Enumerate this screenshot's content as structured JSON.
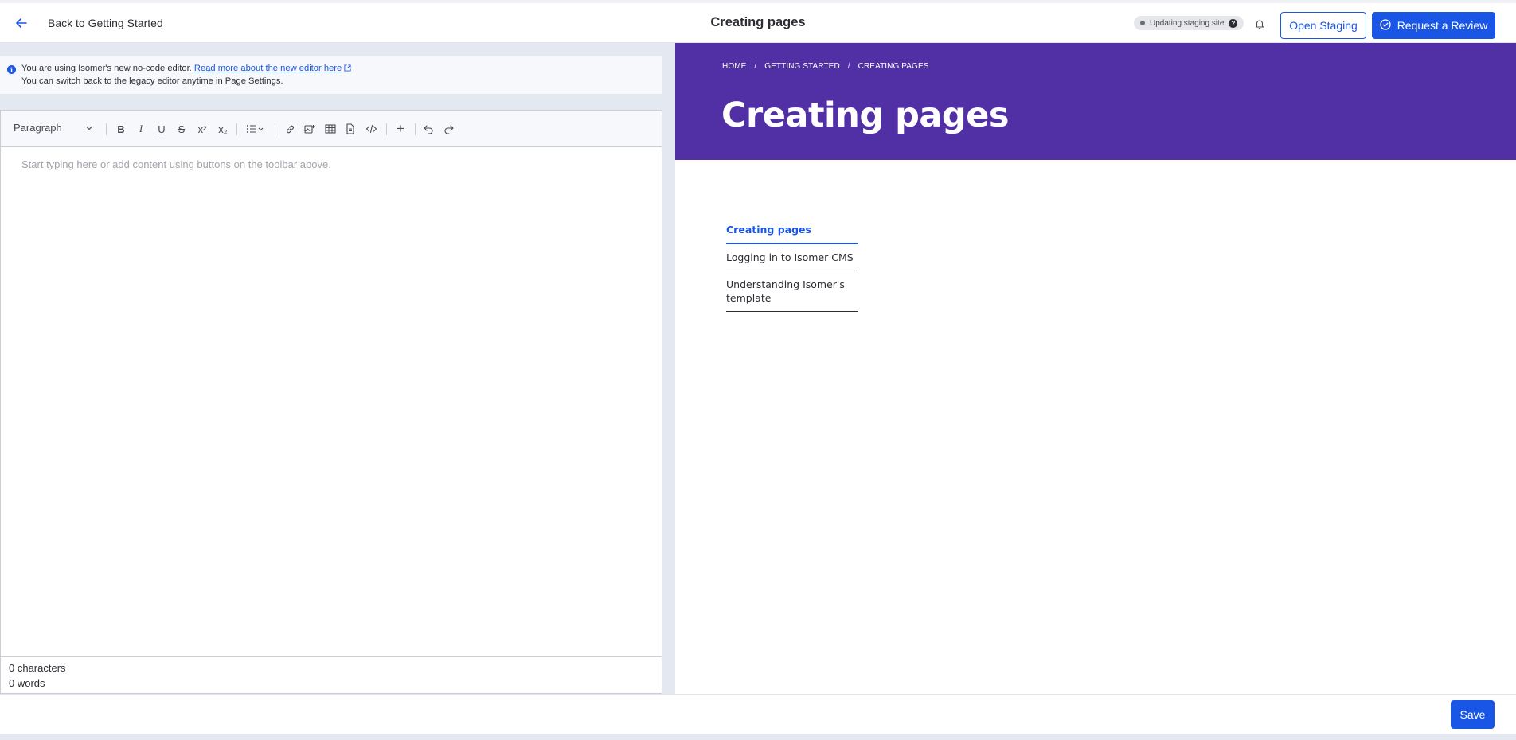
{
  "header": {
    "back_label": "Back to Getting Started",
    "title": "Creating pages",
    "status_text": "Updating staging site",
    "help_glyph": "?",
    "open_staging_label": "Open Staging",
    "request_review_label": "Request a Review"
  },
  "banner": {
    "line1_prefix": "You are using Isomer's new no-code editor.",
    "link_text": "Read more about the new editor here",
    "line2": "You can switch back to the legacy editor anytime in Page Settings.",
    "info_glyph": "i"
  },
  "editor": {
    "block_type": "Paragraph",
    "toolbar": {
      "bold": "B",
      "italic": "I",
      "underline": "U",
      "strike": "S",
      "superscript": "x²",
      "subscript": "x₂",
      "add": "+"
    },
    "placeholder": "Start typing here or add content using buttons on the toolbar above.",
    "char_count": "0 characters",
    "word_count": "0 words"
  },
  "preview": {
    "breadcrumbs": [
      "HOME",
      "GETTING STARTED",
      "CREATING PAGES"
    ],
    "breadcrumb_sep": "/",
    "hero_title": "Creating pages",
    "nav": [
      {
        "label": "Creating pages",
        "active": true
      },
      {
        "label": "Logging in to Isomer CMS",
        "active": false
      },
      {
        "label": "Understanding Isomer's template",
        "active": false
      }
    ],
    "hero_color": "#5130a6"
  },
  "footer": {
    "save_label": "Save"
  },
  "colors": {
    "accent": "#1a56e5",
    "hero": "#5130a6"
  }
}
